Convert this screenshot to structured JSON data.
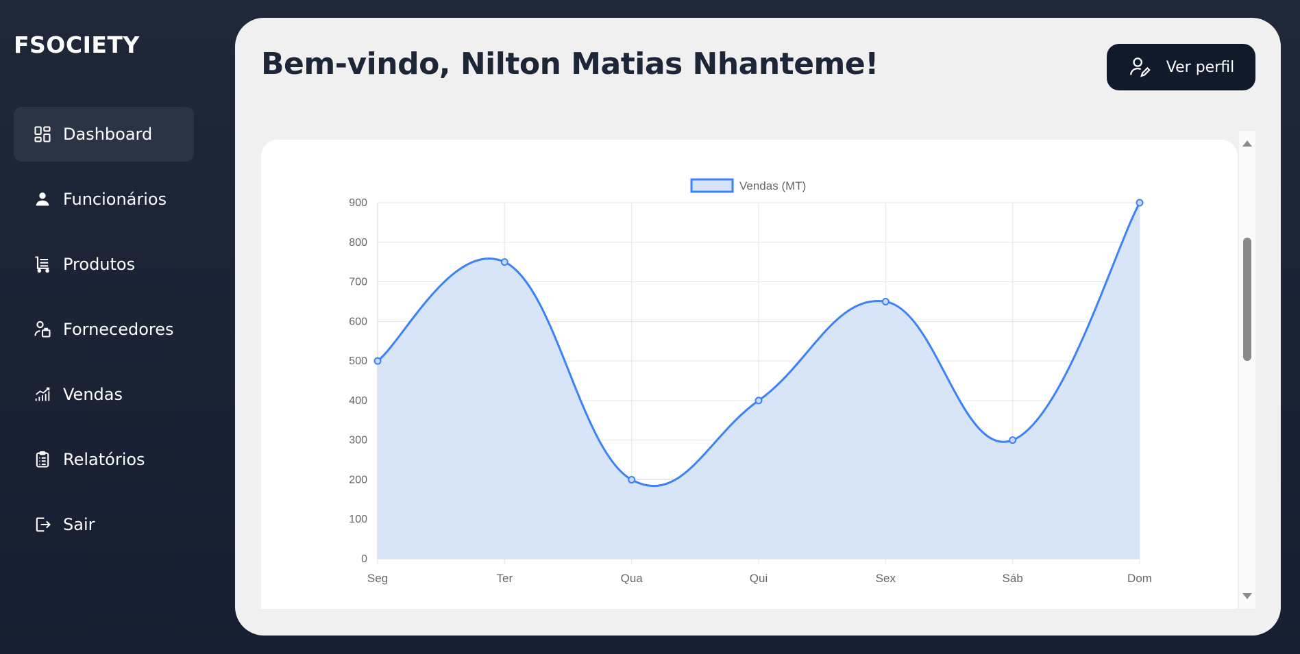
{
  "app": {
    "brand": "FSOCIETY"
  },
  "sidebar": {
    "items": [
      {
        "label": "Dashboard",
        "icon": "dashboard-icon",
        "active": true
      },
      {
        "label": "Funcionários",
        "icon": "person-icon"
      },
      {
        "label": "Produtos",
        "icon": "cart-icon"
      },
      {
        "label": "Fornecedores",
        "icon": "supplier-icon"
      },
      {
        "label": "Vendas",
        "icon": "chart-growth-icon"
      },
      {
        "label": "Relatórios",
        "icon": "clipboard-icon"
      },
      {
        "label": "Sair",
        "icon": "logout-icon"
      }
    ]
  },
  "header": {
    "welcome": "Bem-vindo, Nilton Matias Nhanteme!",
    "profile_button": "Ver perfil"
  },
  "colors": {
    "sidebar_bg": "#1f2839",
    "main_bg": "#f0f0f0",
    "accent_line": "#3b82f6",
    "accent_fill": "#d6e4f9",
    "button_bg": "#111a2b"
  },
  "chart_data": {
    "type": "line",
    "categories": [
      "Seg",
      "Ter",
      "Qua",
      "Qui",
      "Sex",
      "Sáb",
      "Dom"
    ],
    "series": [
      {
        "name": "Vendas (MT)",
        "values": [
          500,
          750,
          200,
          400,
          650,
          300,
          900
        ]
      }
    ],
    "ylim": [
      0,
      900
    ],
    "yticks": [
      0,
      100,
      200,
      300,
      400,
      500,
      600,
      700,
      800,
      900
    ],
    "filled": true,
    "smooth": true,
    "grid": true,
    "legend": "top-center"
  }
}
